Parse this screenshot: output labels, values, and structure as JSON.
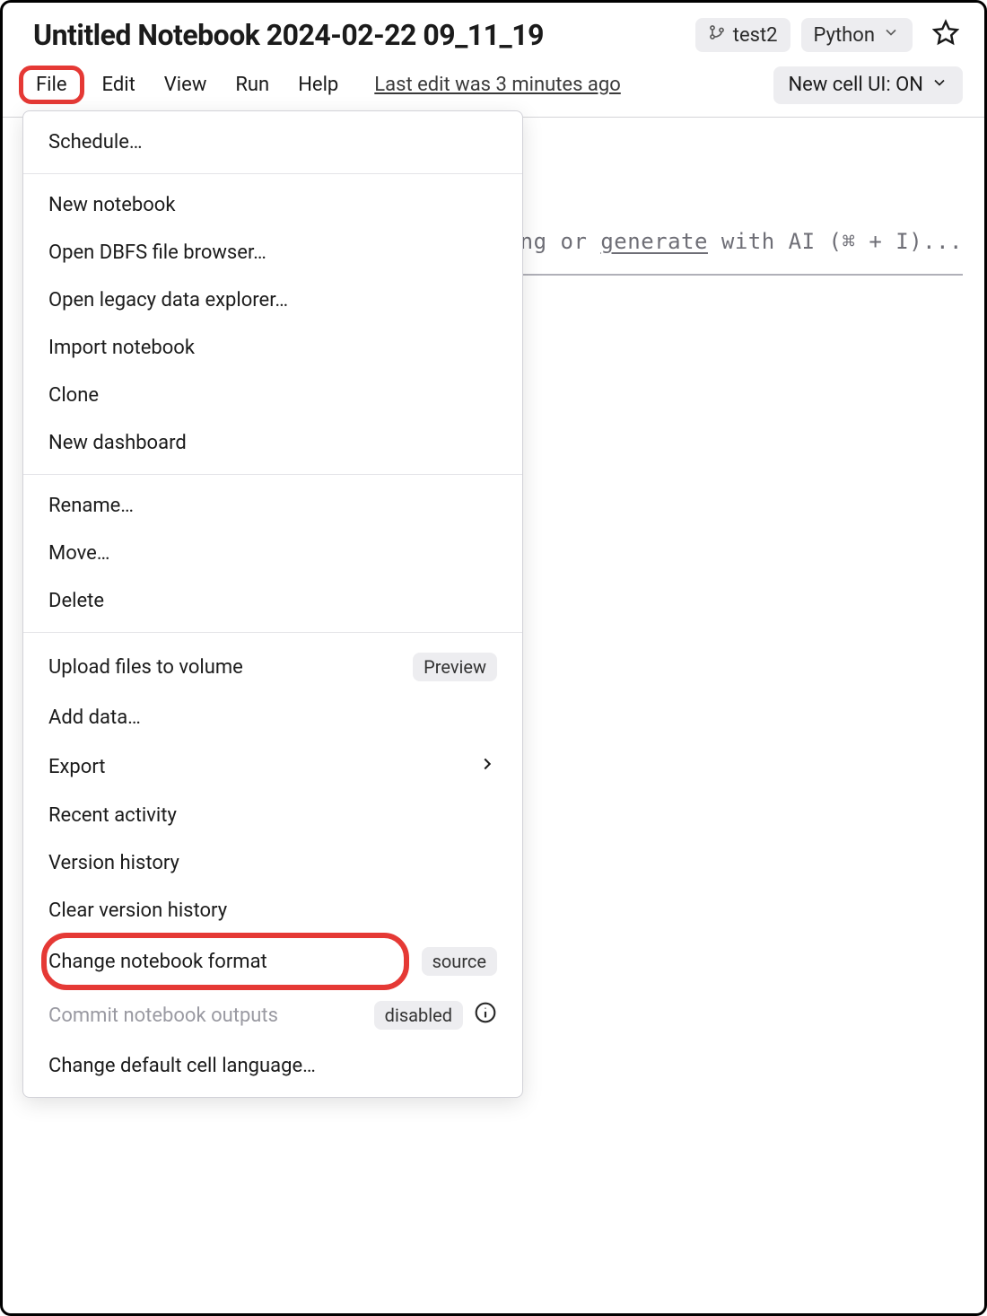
{
  "title": "Untitled Notebook 2024-02-22 09_11_19",
  "header": {
    "branch": "test2",
    "language": "Python"
  },
  "menubar": {
    "file": "File",
    "edit": "Edit",
    "view": "View",
    "run": "Run",
    "help": "Help",
    "last_edit": "Last edit was 3 minutes ago",
    "newcell": "New cell UI: ON"
  },
  "cell_hint": {
    "prefix": "ng or ",
    "generate": "generate",
    "suffix": " with AI (⌘ + I)..."
  },
  "file_menu": {
    "schedule": "Schedule…",
    "new_notebook": "New notebook",
    "open_dbfs": "Open DBFS file browser…",
    "open_legacy": "Open legacy data explorer…",
    "import_nb": "Import notebook",
    "clone": "Clone",
    "new_dashboard": "New dashboard",
    "rename": "Rename…",
    "move": "Move…",
    "delete": "Delete",
    "upload_vol": "Upload files to volume",
    "upload_vol_badge": "Preview",
    "add_data": "Add data…",
    "export": "Export",
    "recent": "Recent activity",
    "version_history": "Version history",
    "clear_history": "Clear version history",
    "change_format": "Change notebook format",
    "change_format_badge": "source",
    "commit_outputs": "Commit notebook outputs",
    "commit_outputs_badge": "disabled",
    "change_lang": "Change default cell language…"
  }
}
